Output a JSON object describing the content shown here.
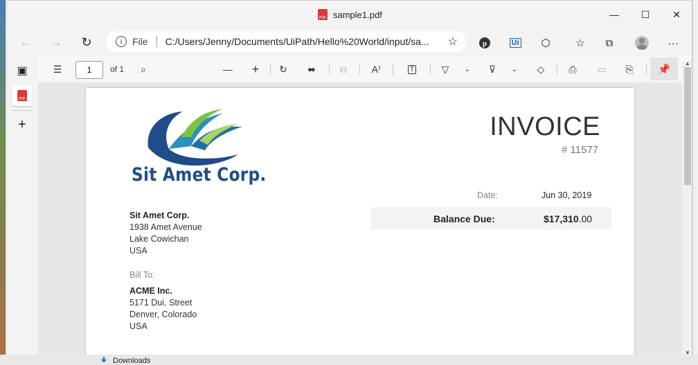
{
  "window": {
    "title": "sample1.pdf",
    "minimize": "—",
    "maximize": "☐",
    "close": "✕"
  },
  "address": {
    "file_label": "File",
    "url": "C:/Users/Jenny/Documents/UiPath/Hello%20World/input/sa..."
  },
  "extensions": {
    "ui_label": "Ui",
    "more": "···"
  },
  "pdf_toolbar": {
    "page_value": "1",
    "page_total": "of 1"
  },
  "invoice": {
    "heading": "INVOICE",
    "number": "# 11577",
    "company_logo_text": "Sit Amet Corp.",
    "from": {
      "name": "Sit Amet Corp.",
      "line1": "1938 Amet Avenue",
      "line2": "Lake Cowichan",
      "line3": "USA"
    },
    "bill_to_label": "Bill To:",
    "to": {
      "name": "ACME Inc.",
      "line1": "5171 Dui, Street",
      "line2": "Denver, Colorado",
      "line3": "USA"
    },
    "date_label": "Date:",
    "date_value": "Jun 30, 2019",
    "balance_label": "Balance Due:",
    "balance_whole": "$17,310",
    "balance_cents": ".00"
  },
  "taskbar": {
    "downloads_label": "Downloads"
  },
  "colors": {
    "logo_blue": "#1f4d8a",
    "logo_green": "#7dc242",
    "pdf_red": "#d83b3b"
  }
}
